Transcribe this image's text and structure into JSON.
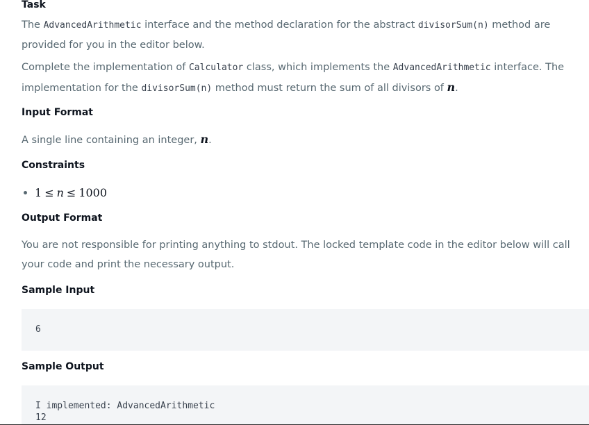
{
  "task": {
    "heading": "Task",
    "p1": {
      "t1": "The ",
      "c1": "AdvancedArithmetic",
      "t2": " interface and the method declaration for the abstract ",
      "c2": "divisorSum(n)",
      "t3": " method are provided for you in the editor below."
    },
    "p2": {
      "t1": "Complete the implementation of ",
      "c1": "Calculator",
      "t2": " class, which implements the ",
      "c2": "AdvancedArithmetic",
      "t3": " interface. The implementation for the ",
      "c3": "divisorSum(n)",
      "t4": " method must return the sum of all divisors of ",
      "m1": "n",
      "t5": "."
    }
  },
  "input_format": {
    "heading": "Input Format",
    "text": "A single line containing an integer, ",
    "var": "n",
    "end": "."
  },
  "constraints": {
    "heading": "Constraints",
    "items": [
      {
        "low": "1",
        "op1": "≤",
        "var": "n",
        "op2": "≤",
        "high": "1000"
      }
    ]
  },
  "output_format": {
    "heading": "Output Format",
    "text": "You are not responsible for printing anything to stdout. The locked template code in the editor below will call your code and print the necessary output."
  },
  "sample_input": {
    "heading": "Sample Input",
    "lines": [
      "6"
    ]
  },
  "sample_output": {
    "heading": "Sample Output",
    "lines": [
      "I implemented: AdvancedArithmetic",
      "12"
    ]
  }
}
